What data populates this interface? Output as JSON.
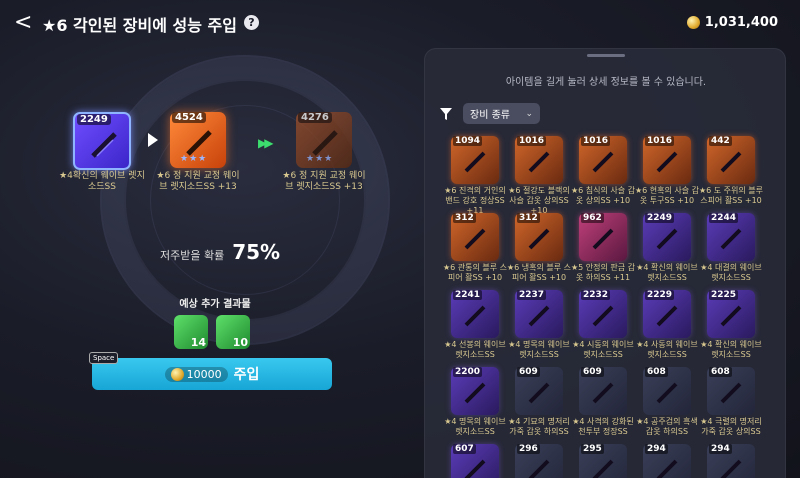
{
  "header": {
    "back_label": "<",
    "title": "★6 각인된 장비에 성능 주입",
    "help_label": "?",
    "currency_amount": "1,031,400"
  },
  "injection": {
    "source": {
      "level": "2249",
      "name": "★4확신의 웨이브 렛지소드SS",
      "stars": ""
    },
    "middle": {
      "level": "4524",
      "name": "★6 정 지원 교정 웨이브 렛지소드SS +13",
      "stars": "★★★"
    },
    "result": {
      "level": "4276",
      "name": "★6 정 지원 교정 웨이브 렛지소드SS +13",
      "stars": "★★★"
    },
    "probability_label": "저주받을 확률",
    "probability_value": "75%",
    "extra_title": "예상 추가 결과물",
    "extras": [
      {
        "count": "14"
      },
      {
        "count": "10"
      }
    ],
    "space_key": "Space",
    "button_cost": "10000",
    "button_label": "주입"
  },
  "panel": {
    "hint": "아이템을 길게 눌러 상세 정보를 볼 수 있습니다.",
    "filter_label": "장비 종류",
    "items": [
      {
        "num": "1094",
        "cap": "★6 진격의 거인의 밴드 강호 정상SS +11",
        "color": "orange"
      },
      {
        "num": "1016",
        "cap": "★6 절강도 블랙의 사슬 갑옷 상의SS +10",
        "color": "orange"
      },
      {
        "num": "1016",
        "cap": "★6 침식의 사슬 갑옷 상의SS +10",
        "color": "orange"
      },
      {
        "num": "1016",
        "cap": "★6 현혹의 사슬 갑옷 투구SS +10",
        "color": "orange"
      },
      {
        "num": "442",
        "cap": "★6 도 주위의 블루 스피어 활SS +10",
        "color": "orange"
      },
      {
        "num": "312",
        "cap": "★6 관통의 블루 스피어 활SS +10",
        "color": "orange"
      },
      {
        "num": "312",
        "cap": "★6 냉혹의 블루 스피어 활SS +10",
        "color": "orange"
      },
      {
        "num": "962",
        "cap": "★5 안정의 판금 갑옷 하의SS +11",
        "color": "pink"
      },
      {
        "num": "2249",
        "cap": "★4 확신의 웨이브 렛지소드SS",
        "color": "purple"
      },
      {
        "num": "2244",
        "cap": "★4 대결의 웨이브 렛지소드SS",
        "color": "purple"
      },
      {
        "num": "2241",
        "cap": "★4 선봉의 웨이브 렛지소드SS",
        "color": "purple"
      },
      {
        "num": "2237",
        "cap": "★4 명목의 웨이브 렛지소드SS",
        "color": "purple"
      },
      {
        "num": "2232",
        "cap": "★4 시동의 웨이브 렛지소드SS",
        "color": "purple"
      },
      {
        "num": "2229",
        "cap": "★4 사동의 웨이브 렛지소드SS",
        "color": "purple"
      },
      {
        "num": "2225",
        "cap": "★4 확신의 웨이브 렛지소드SS",
        "color": "purple"
      },
      {
        "num": "2200",
        "cap": "★4 명목의 웨이브 렛지소드SS",
        "color": "purple"
      },
      {
        "num": "609",
        "cap": "★4 기묘의 명저리 가죽 갑옷 하의SS",
        "color": "dark"
      },
      {
        "num": "609",
        "cap": "★4 사격의 강화된 천투부 정장SS",
        "color": "dark"
      },
      {
        "num": "608",
        "cap": "★4 공주검의 흑색 갑옷 하의SS",
        "color": "dark"
      },
      {
        "num": "608",
        "cap": "★4 극렬의 명저리 가죽 갑옷 상의SS",
        "color": "dark"
      },
      {
        "num": "607",
        "cap": "",
        "color": "purple"
      },
      {
        "num": "296",
        "cap": "",
        "color": "dark"
      },
      {
        "num": "295",
        "cap": "",
        "color": "dark"
      },
      {
        "num": "294",
        "cap": "",
        "color": "dark"
      },
      {
        "num": "294",
        "cap": "",
        "color": "dark"
      }
    ]
  }
}
